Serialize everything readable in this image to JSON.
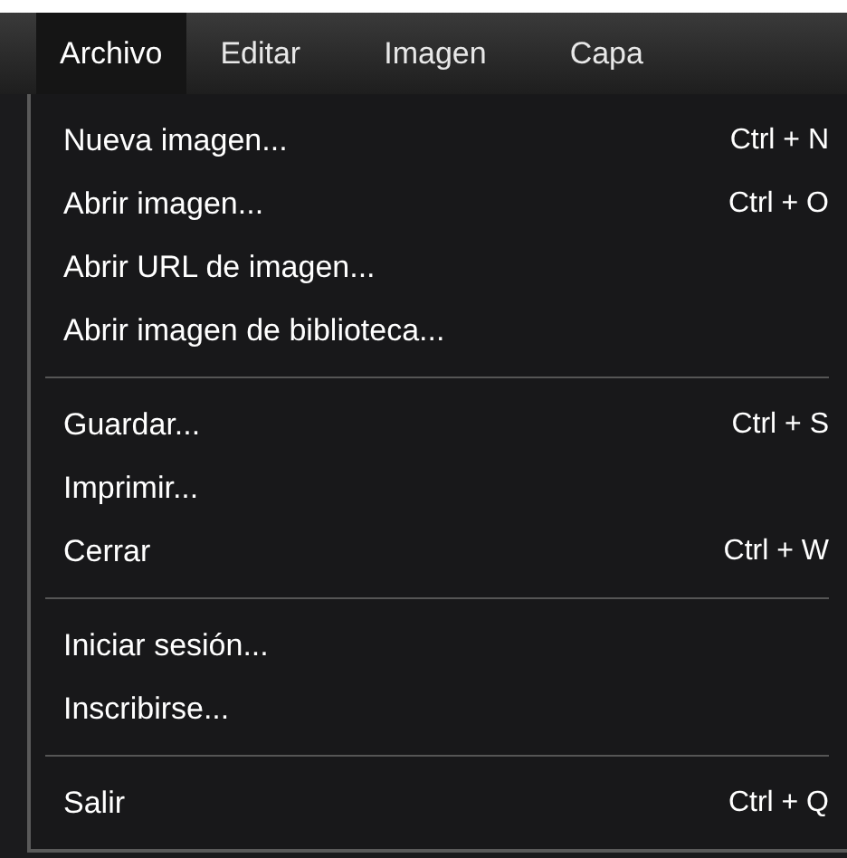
{
  "menubar": [
    {
      "label": "Archivo",
      "selected": true
    },
    {
      "label": "Editar",
      "selected": false
    },
    {
      "label": "Imagen",
      "selected": false
    },
    {
      "label": "Capa",
      "selected": false
    }
  ],
  "menu": {
    "sections": [
      {
        "items": [
          {
            "label": "Nueva imagen...",
            "shortcut": "Ctrl + N"
          },
          {
            "label": "Abrir imagen...",
            "shortcut": "Ctrl + O"
          },
          {
            "label": "Abrir URL de imagen..."
          },
          {
            "label": "Abrir imagen de biblioteca..."
          }
        ]
      },
      {
        "items": [
          {
            "label": "Guardar...",
            "shortcut": "Ctrl + S"
          },
          {
            "label": "Imprimir..."
          },
          {
            "label": "Cerrar",
            "shortcut": "Ctrl + W"
          }
        ]
      },
      {
        "items": [
          {
            "label": "Iniciar sesión..."
          },
          {
            "label": "Inscribirse..."
          }
        ]
      },
      {
        "items": [
          {
            "label": "Salir",
            "shortcut": "Ctrl + Q"
          }
        ]
      }
    ]
  }
}
